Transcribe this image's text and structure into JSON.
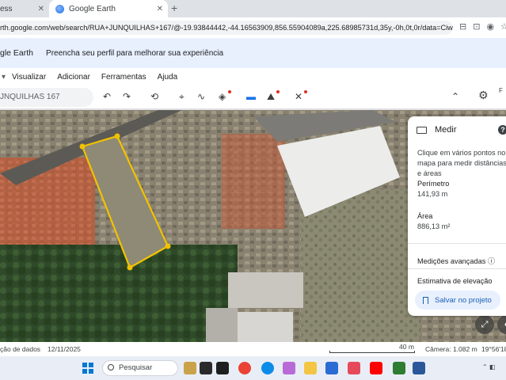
{
  "browser": {
    "tabs": [
      {
        "label": "ess",
        "active": false
      },
      {
        "label": "Google Earth",
        "active": true
      }
    ],
    "new_tab": "+",
    "close_glyph": "✕",
    "url": "rth.google.com/web/search/RUA+JUNQUILHAS+167/@-19.93844442,-44.16563909,856.55904089a,225.68985731d,35y,-0h,0t,0r/data=CiwiJgokC..."
  },
  "banner": {
    "brand": "gle Earth",
    "message": "Preencha seu perfil para melhorar sua experiência"
  },
  "menu": {
    "items": [
      "Visualizar",
      "Adicionar",
      "Ferramentas",
      "Ajuda"
    ]
  },
  "toolbar": {
    "search_value": "JNQUILHAS 167",
    "account_initial": "F"
  },
  "measure_panel": {
    "title": "Medir",
    "hint": "Clique em vários pontos no mapa para medir distâncias e áreas",
    "perimeter_label": "Perímetro",
    "perimeter_value": "141,93 m",
    "area_label": "Área",
    "area_value": "886,13 m²",
    "advanced_label": "Medições avançadas",
    "elevation_label": "Estimativa de elevação",
    "save_label": "Salvar no projeto"
  },
  "status": {
    "credits": "ção de dados",
    "date": "12/11/2025",
    "scale": "40 m",
    "camera": "Câmera: 1.082 m",
    "coord": "19°56'18"
  },
  "taskbar": {
    "search_label": "Pesquisar"
  },
  "colors": {
    "polygon": "#f2c200",
    "accent": "#1a73e8",
    "banner_bg": "#e8f0fe"
  }
}
